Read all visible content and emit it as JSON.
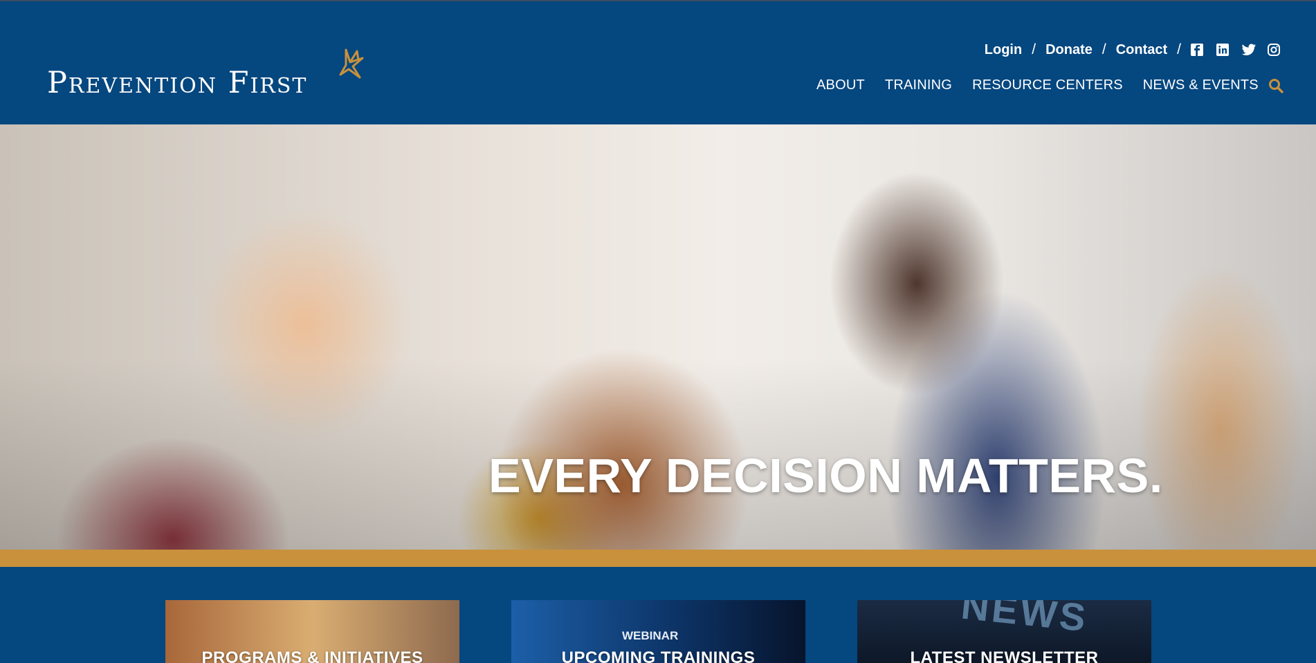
{
  "header": {
    "logo_text": "Prevention First",
    "utility_links": [
      "Login",
      "Donate",
      "Contact"
    ],
    "separator": "/",
    "social_icons": [
      "facebook-icon",
      "linkedin-icon",
      "twitter-icon",
      "instagram-icon"
    ],
    "nav": [
      "ABOUT",
      "TRAINING",
      "RESOURCE CENTERS",
      "NEWS & EVENTS"
    ],
    "search_icon": "search-icon"
  },
  "hero": {
    "title": "EVERY DECISION MATTERS."
  },
  "cards": [
    {
      "label": "PROGRAMS & INITIATIVES"
    },
    {
      "label": "UPCOMING TRAININGS",
      "image_text": "WEBINAR"
    },
    {
      "label": "LATEST NEWSLETTER",
      "image_text": "NEWS"
    }
  ],
  "colors": {
    "brand_blue": "#05477f",
    "accent_gold": "#c9913c",
    "text": "#ffffff"
  }
}
